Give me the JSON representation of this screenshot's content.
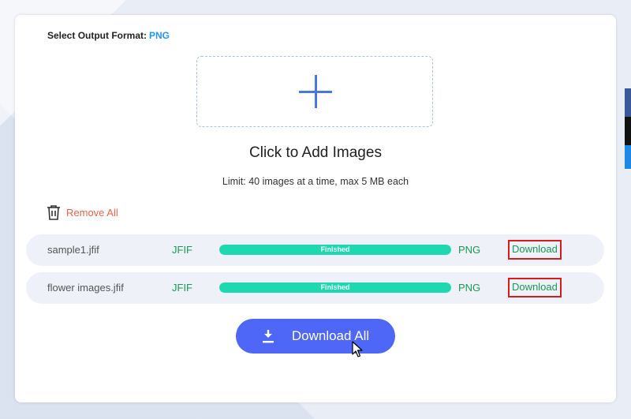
{
  "dialog": {
    "format_label": "Select Output Format:",
    "format_value": "PNG",
    "add_title": "Click to Add Images",
    "limit_text": "Limit: 40 images at a time, max 5 MB each",
    "remove_all_label": "Remove All",
    "download_all_label": "Download All"
  },
  "files": [
    {
      "name": "sample1.jfif",
      "source_format": "JFIF",
      "status": "Finished",
      "progress": 100,
      "target_format": "PNG",
      "download_label": "Download"
    },
    {
      "name": "flower images.jfif",
      "source_format": "JFIF",
      "status": "Finished",
      "progress": 100,
      "target_format": "PNG",
      "download_label": "Download"
    }
  ],
  "icons": {
    "plus": "plus-icon",
    "trash": "trash-icon",
    "download": "download-icon",
    "cursor": "mouse-cursor-icon"
  },
  "colors": {
    "accent_blue": "#4f67f6",
    "format_blue": "#2196f3",
    "green_text": "#1a9a55",
    "progress_fill": "#1ed9b0",
    "remove_red": "#e8654a",
    "highlight_border": "#d81b1b"
  }
}
